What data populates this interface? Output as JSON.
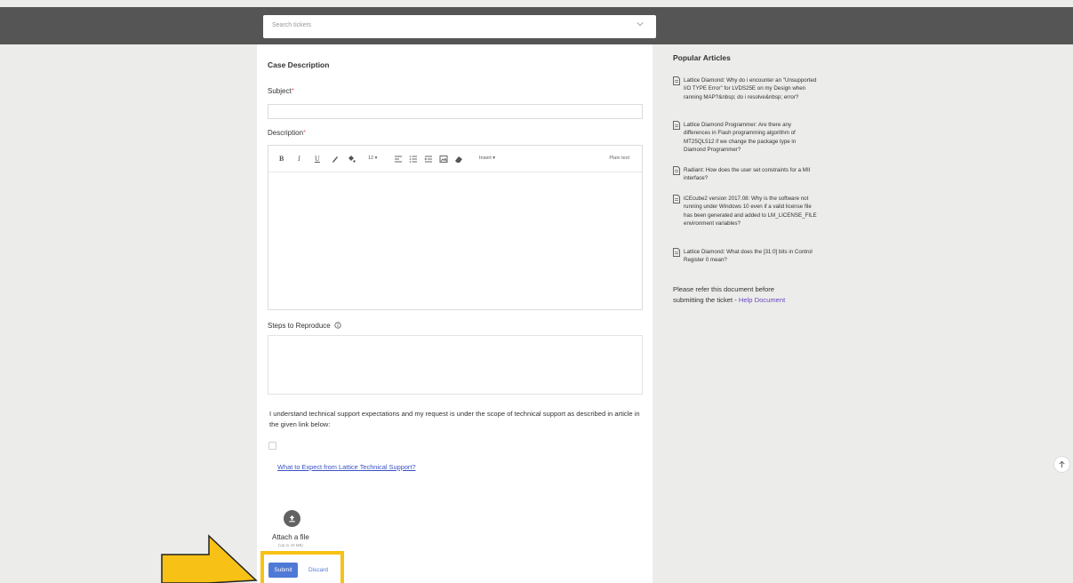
{
  "search": {
    "placeholder": "Search tickets"
  },
  "form": {
    "section_title": "Case Description",
    "subject_label": "Subject",
    "description_label": "Description",
    "required_mark": "*",
    "editor": {
      "bold": "B",
      "italic": "I",
      "underline": "U",
      "font_size": "12 ▾",
      "insert": "Insert ▾",
      "plain_text": "Plain text"
    },
    "steps_label": "Steps to Reproduce",
    "acknowledgement": "I understand technical support expectations and my request is under the scope of technical support as described in article in the given link below:",
    "support_link": "What to Expect from Lattice Technical Support?",
    "attach_label": "Attach a file",
    "attach_size": "(Up to 40 MB)",
    "submit_label": "Submit",
    "discard_label": "Discard"
  },
  "sidebar": {
    "title": "Popular Articles",
    "articles": [
      "Lattice Diamond: Why do i encounter an \"Unsupported I/O TYPE Error\" for LVDS25E on my Design when ranning MAP?&nbsp; do i resolve&nbsp; error?",
      "Lattice Diamond Programmer: Are there any differences in Flash programming algorithm of MT25QL512 if we change the package type in Diamond Programmer?",
      "Radiant: How does the user set constraints for a MII interface?",
      "iCEcube2 version 2017.08: Why is the software not running under Windows 10 even if a valid license file has been generated and added to LM_LICENSE_FILE environment variables?",
      "Lattice Diamond: What does the [31:0] bits in Control Register 0 mean?"
    ],
    "refer_text": "Please refer this document before submitting the ticket - ",
    "help_link": "Help Document"
  },
  "colors": {
    "topbar": "#555556",
    "submit": "#4e79d6",
    "highlight": "#f7c215",
    "link": "#3a52c4",
    "help_link": "#6a48c0"
  },
  "icons": [
    "chevron-down-icon",
    "info-icon",
    "upload-icon",
    "document-icon",
    "arrow-up-icon",
    "eraser-icon",
    "image-icon",
    "list-icon"
  ]
}
